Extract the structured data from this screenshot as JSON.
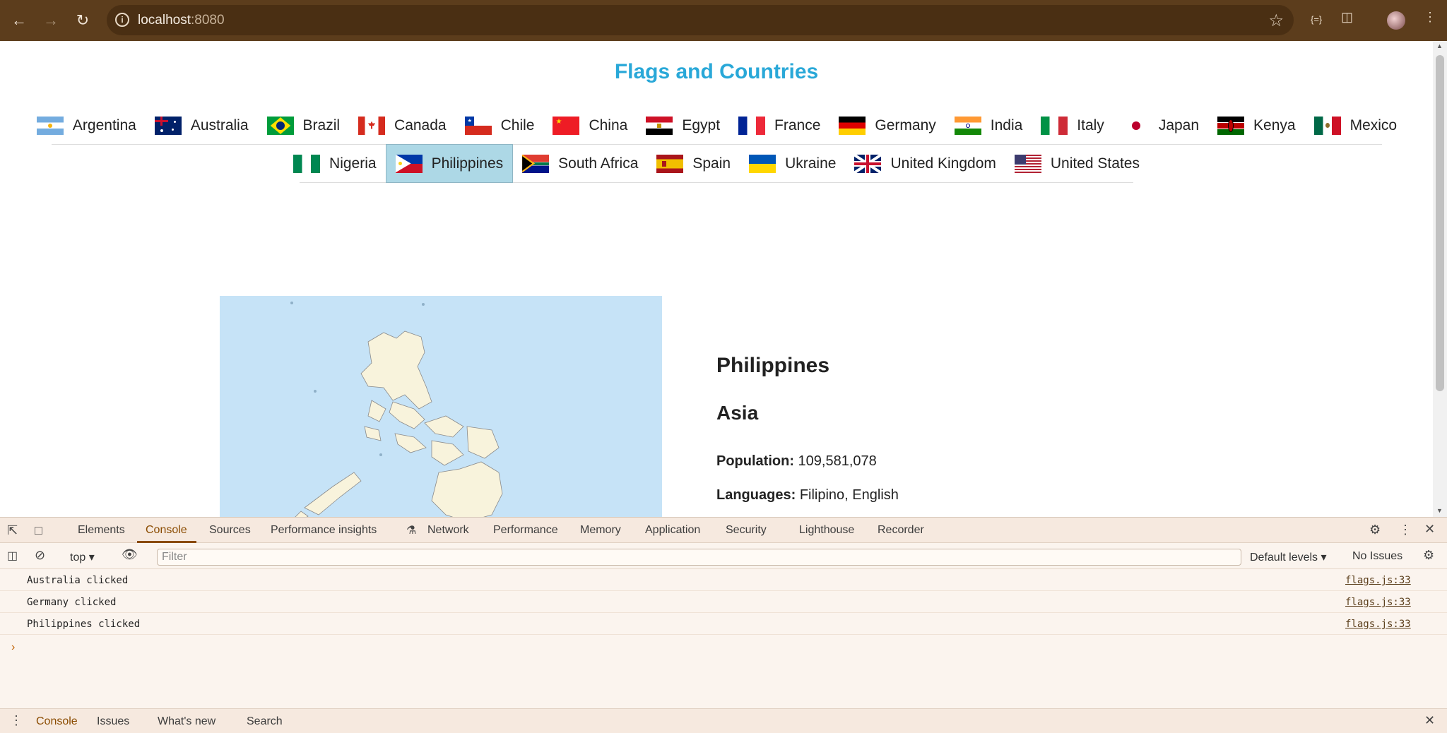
{
  "browser": {
    "url_host": "localhost",
    "url_port": ":8080"
  },
  "page": {
    "title": "Flags and Countries",
    "selected_country": "Philippines",
    "flags_row1": [
      "Argentina",
      "Australia",
      "Brazil",
      "Canada",
      "Chile",
      "China",
      "Egypt",
      "France",
      "Germany",
      "India",
      "Italy",
      "Japan",
      "Kenya",
      "Mexico"
    ],
    "flags_row2": [
      "Nigeria",
      "Philippines",
      "South Africa",
      "Spain",
      "Ukraine",
      "United Kingdom",
      "United States"
    ],
    "info": {
      "name": "Philippines",
      "continent": "Asia",
      "population_label": "Population:",
      "population_value": "109,581,078",
      "languages_label": "Languages:",
      "languages_value": "Filipino, English"
    }
  },
  "devtools": {
    "tabs": [
      "Elements",
      "Console",
      "Sources",
      "Performance insights",
      "Network",
      "Performance",
      "Memory",
      "Application",
      "Security",
      "Lighthouse",
      "Recorder"
    ],
    "active_tab": "Console",
    "context": "top",
    "filter_placeholder": "Filter",
    "levels": "Default levels",
    "issues": "No Issues",
    "logs": [
      {
        "message": "Australia clicked",
        "source": "flags.js:33"
      },
      {
        "message": "Germany clicked",
        "source": "flags.js:33"
      },
      {
        "message": "Philippines clicked",
        "source": "flags.js:33"
      }
    ],
    "drawer_tabs": [
      "Console",
      "Issues",
      "What's new",
      "Search"
    ]
  }
}
